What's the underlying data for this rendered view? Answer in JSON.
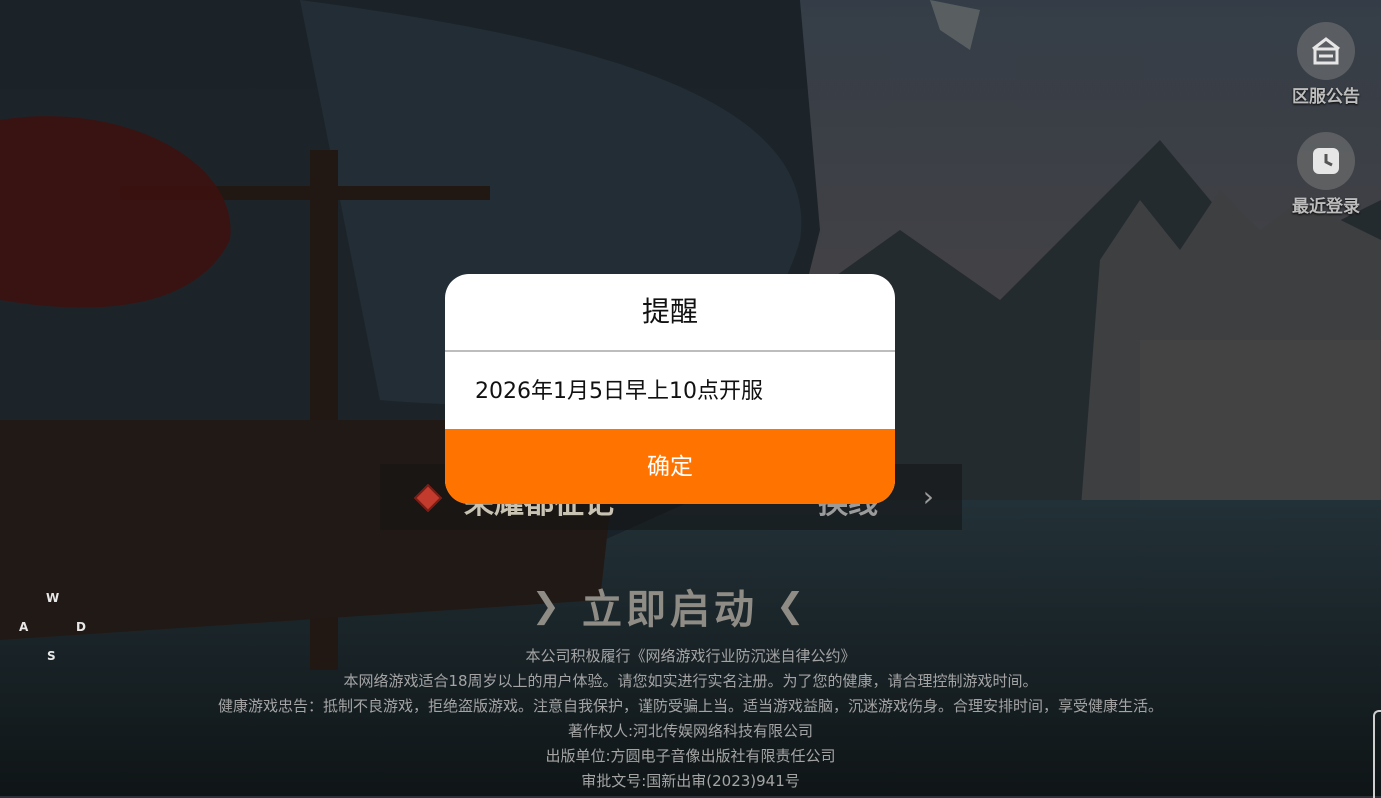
{
  "top_right": {
    "announcement_label": "区服公告",
    "recent_login_label": "最近登录"
  },
  "server": {
    "name": "荣耀都征记",
    "switch_label": "换线"
  },
  "start_button": {
    "label": "立即启动"
  },
  "notice_lines": [
    "本公司积极履行《网络游戏行业防沉迷自律公约》",
    "本网络游戏适合18周岁以上的用户体验。请您如实进行实名注册。为了您的健康，请合理控制游戏时间。",
    "健康游戏忠告：抵制不良游戏，拒绝盗版游戏。注意自我保护，谨防受骗上当。适当游戏益脑，沉迷游戏伤身。合理安排时间，享受健康生活。",
    "著作权人:河北传娱网络科技有限公司",
    "出版单位:方圆电子音像出版社有限责任公司",
    "审批文号:国新出审(2023)941号"
  ],
  "wasd": {
    "w": "W",
    "a": "A",
    "s": "S",
    "d": "D"
  },
  "dialog": {
    "title": "提醒",
    "message": "2026年1月5日早上10点开服",
    "confirm_label": "确定"
  },
  "colors": {
    "accent": "#ff7300",
    "dialog_bg": "#ffffff"
  },
  "icons": {
    "announcement": "house-board-icon",
    "recent_login": "clock-icon",
    "server": "red-diamond-icon"
  }
}
